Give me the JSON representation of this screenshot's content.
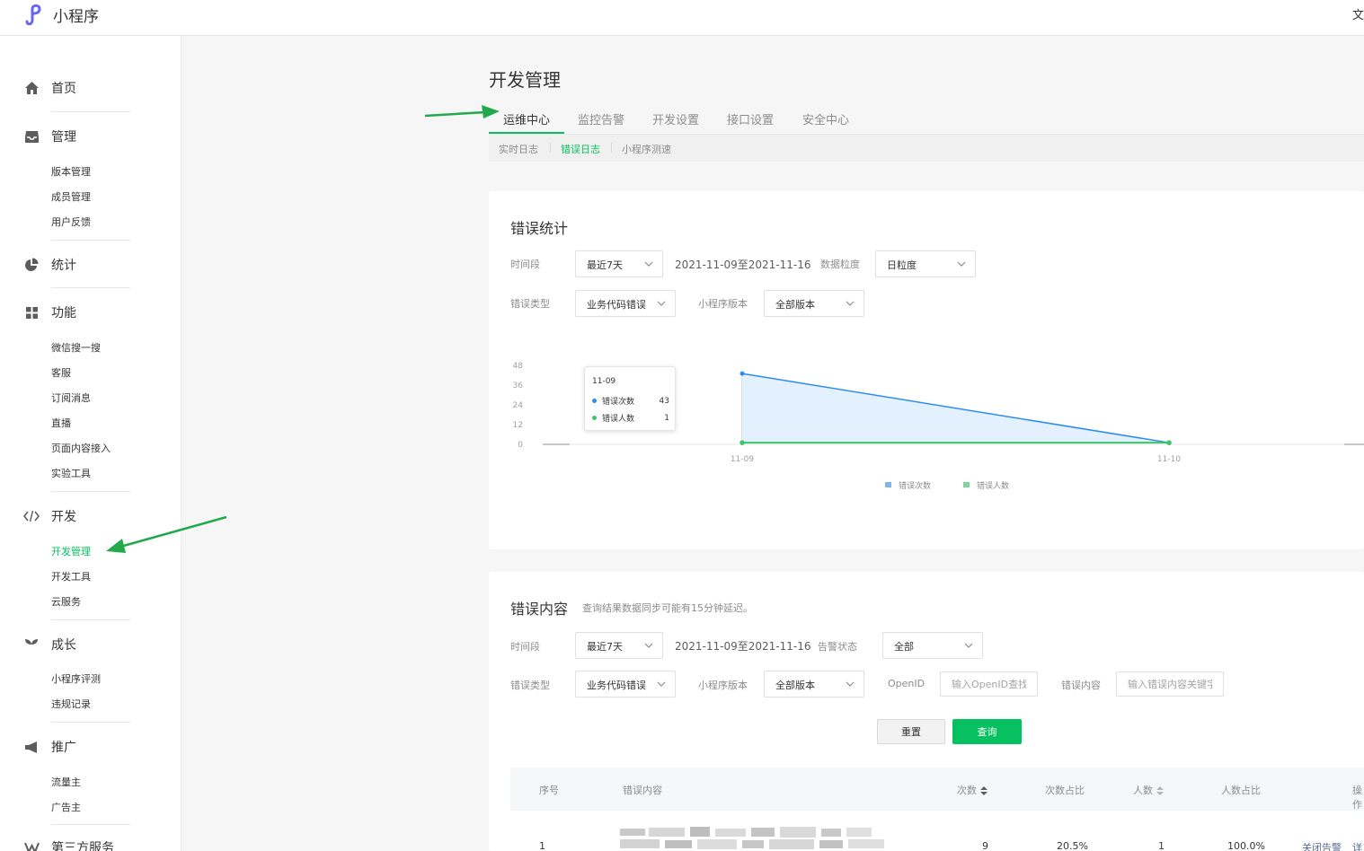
{
  "app": {
    "name": "小程序",
    "header_right": "文"
  },
  "sidebar": {
    "groups": [
      {
        "label": "首页",
        "icon": "home-icon",
        "items": []
      },
      {
        "label": "管理",
        "icon": "inbox-icon",
        "items": [
          "版本管理",
          "成员管理",
          "用户反馈"
        ]
      },
      {
        "label": "统计",
        "icon": "pie-chart-icon",
        "items": []
      },
      {
        "label": "功能",
        "icon": "grid-icon",
        "items": [
          "微信搜一搜",
          "客服",
          "订阅消息",
          "直播",
          "页面内容接入",
          "实验工具"
        ]
      },
      {
        "label": "开发",
        "icon": "code-icon",
        "items": [
          "开发管理",
          "开发工具",
          "云服务"
        ]
      },
      {
        "label": "成长",
        "icon": "sprout-icon",
        "items": [
          "小程序评测",
          "违规记录"
        ]
      },
      {
        "label": "推广",
        "icon": "megaphone-icon",
        "items": [
          "流量主",
          "广告主"
        ]
      },
      {
        "label": "第三方服务",
        "icon": "third-party-icon",
        "items": []
      }
    ],
    "active_item": "开发管理"
  },
  "page": {
    "title": "开发管理",
    "tabs": [
      "运维中心",
      "监控告警",
      "开发设置",
      "接口设置",
      "安全中心"
    ],
    "subtabs": [
      "实时日志",
      "错误日志",
      "小程序测速"
    ]
  },
  "stats": {
    "title": "错误统计",
    "period_label": "时间段",
    "period_value": "最近7天",
    "date_range": "2021-11-09至2021-11-16",
    "granularity_label": "数据粒度",
    "granularity_value": "日粒度",
    "error_type_label": "错误类型",
    "error_type_value": "业务代码错误",
    "version_label": "小程序版本",
    "version_value": "全部版本"
  },
  "chart_data": {
    "type": "area",
    "x": [
      "11-09",
      "11-10"
    ],
    "y_ticks": [
      0,
      12,
      24,
      36,
      48
    ],
    "ylim": [
      0,
      48
    ],
    "series": [
      {
        "name": "错误次数",
        "values": [
          43,
          1
        ],
        "color": "#2d8cf0"
      },
      {
        "name": "错误人数",
        "values": [
          1,
          1
        ],
        "color": "#3dc56e"
      }
    ],
    "tooltip": {
      "title": "11-09",
      "rows": [
        {
          "name": "错误次数",
          "value": "43"
        },
        {
          "name": "错误人数",
          "value": "1"
        }
      ]
    },
    "legend": "bottom"
  },
  "errors": {
    "title": "错误内容",
    "note": "查询结果数据同步可能有15分钟延迟。",
    "period_label": "时间段",
    "period_value": "最近7天",
    "date_range": "2021-11-09至2021-11-16",
    "alert_label": "告警状态",
    "alert_value": "全部",
    "error_type_label": "错误类型",
    "error_type_value": "业务代码错误",
    "version_label": "小程序版本",
    "version_value": "全部版本",
    "openid_label": "OpenID",
    "openid_placeholder": "输入OpenID查找",
    "content_label": "错误内容",
    "content_placeholder": "输入错误内容关键字",
    "reset_label": "重置",
    "query_label": "查询",
    "columns": [
      "序号",
      "错误内容",
      "次数",
      "次数占比",
      "人数",
      "人数占比",
      "操作"
    ],
    "rows": [
      {
        "index": "1",
        "count": "9",
        "count_ratio": "20.5%",
        "users": "1",
        "user_ratio": "100.0%",
        "action1": "关闭告警",
        "action2": "详"
      }
    ]
  },
  "colors": {
    "accent": "#07c160",
    "link": "#576b95",
    "arrow": "#22a94b"
  }
}
